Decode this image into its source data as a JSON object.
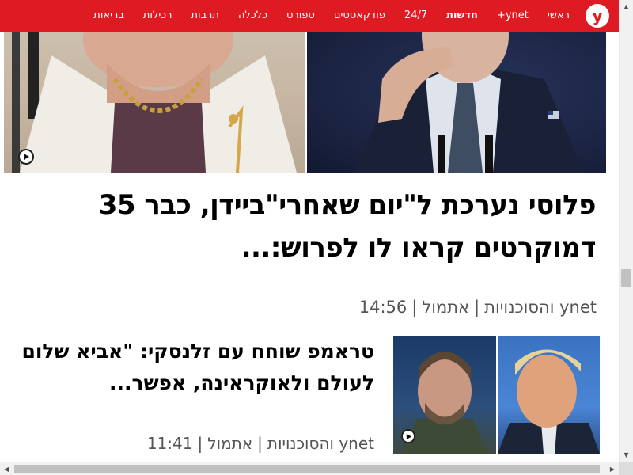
{
  "nav": {
    "logo_letter": "y",
    "items": [
      {
        "label": "ראשי",
        "active": false
      },
      {
        "label": "ynet+",
        "active": false
      },
      {
        "label": "חדשות",
        "active": true
      },
      {
        "label": "24/7",
        "active": false
      },
      {
        "label": "פודקאסטים",
        "active": false
      },
      {
        "label": "ספורט",
        "active": false
      },
      {
        "label": "כלכלה",
        "active": false
      },
      {
        "label": "תרבות",
        "active": false
      },
      {
        "label": "רכילות",
        "active": false
      },
      {
        "label": "בריאות",
        "active": false
      }
    ],
    "colors": {
      "bar": "#de1b22",
      "text": "#ffffff"
    }
  },
  "main_article": {
    "headline": "פלוסי נערכת ל\"יום שאחרי\"ביידן, כבר 35 דמוקרטים קראו לו לפרוש:...",
    "source": "ynet והסוכנויות",
    "day": "אתמול",
    "time": "14:56",
    "has_video": true
  },
  "second_article": {
    "headline": "טראמפ שוחח עם זלנסקי: \"אביא שלום לעולם ולאוקראינה, אפשר...",
    "source": "ynet והסוכנויות",
    "day": "אתמול",
    "time": "11:41",
    "has_video": true
  }
}
